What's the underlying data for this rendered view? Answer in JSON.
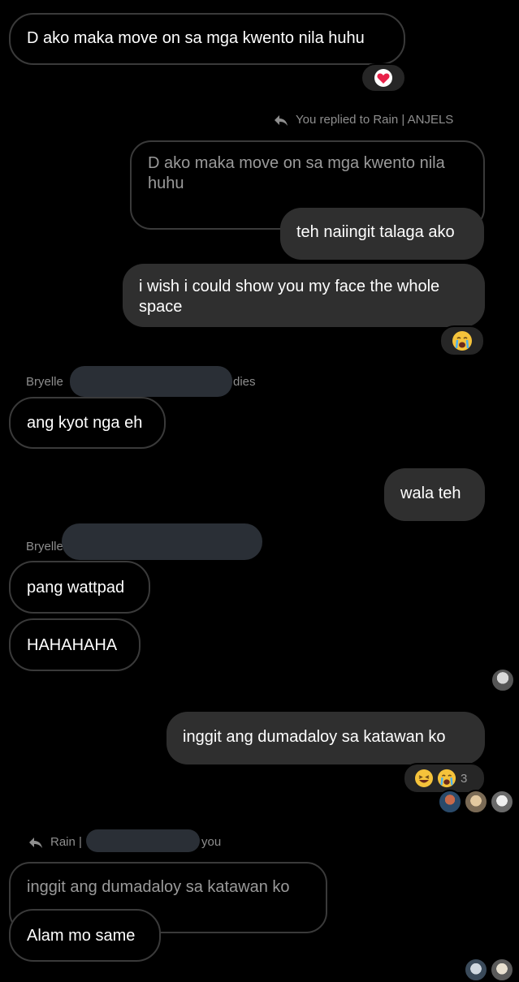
{
  "messages": {
    "m1": "D ako maka move on sa mga kwento nila huhu",
    "reply_header": "You replied to Rain | ANJELS",
    "quoted1": "D ako maka move on sa mga kwento nila huhu",
    "m2": "teh naiingit talaga ako",
    "m3": "i wish i could show you my face the whole space",
    "sender1_name": "Bryelle",
    "sender1_suffix": "dies",
    "m4": "ang kyot nga eh",
    "m5": "wala teh",
    "sender2_name": "Bryelle",
    "m6": "pang wattpad",
    "m7": "HAHAHAHA",
    "m8": "inggit ang dumadaloy sa katawan ko",
    "reaction_count": "3",
    "reply2_prefix": "Rain |",
    "reply2_suffix": "you",
    "quoted2": "inggit ang dumadaloy sa katawan ko",
    "m9": "Alam mo same"
  },
  "reactions": {
    "r1": "heart-emoji",
    "r2": "crying-emoji",
    "r3": [
      "laughing-emoji",
      "crying-emoji"
    ]
  },
  "colors": {
    "background": "#000000",
    "my_bubble": "#2f2f2f",
    "outline": "#3a3a3a",
    "meta_text": "#8e8e8e"
  }
}
